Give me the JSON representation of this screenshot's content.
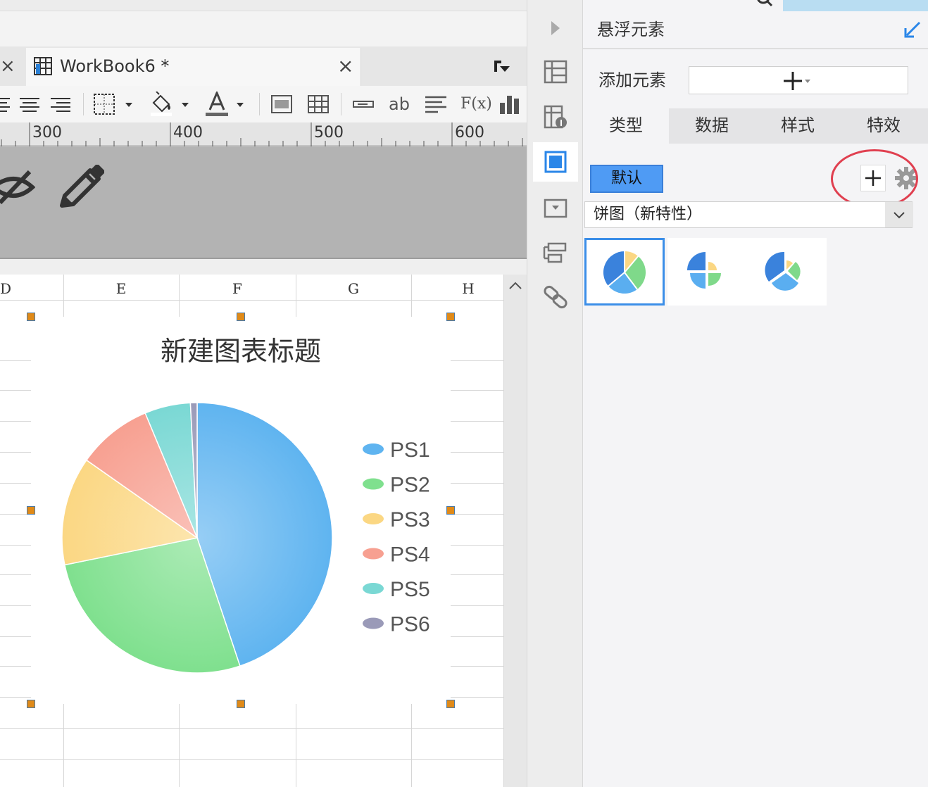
{
  "editor": {
    "tab_title": "WorkBook6 *",
    "toolbar_text": {
      "ab": "ab",
      "fx": "F(x)"
    },
    "ruler_labels": [
      "300",
      "400",
      "500",
      "600"
    ],
    "columns": [
      "D",
      "E",
      "F",
      "G",
      "H"
    ]
  },
  "chart_data": {
    "type": "pie",
    "title": "新建图表标题",
    "categories": [
      "PS1",
      "PS2",
      "PS3",
      "PS4",
      "PS5",
      "PS6"
    ],
    "values": [
      45,
      27,
      13,
      9,
      5.5,
      0.8
    ],
    "colors": [
      "#5fb4f0",
      "#7fe08e",
      "#fbd783",
      "#f7a091",
      "#7ad8d4",
      "#9a9ab8"
    ],
    "legend_position": "right"
  },
  "panel": {
    "title": "悬浮元素",
    "add_element_label": "添加元素",
    "tabs": [
      "类型",
      "数据",
      "样式",
      "特效"
    ],
    "active_tab": "类型",
    "default_button": "默认",
    "chart_type_select": "饼图（新特性）",
    "thumbnails": [
      "pie-chart-thumb",
      "pie-quadrant-thumb",
      "pie-exploded-thumb"
    ]
  },
  "colors": {
    "accent": "#4f9bf4",
    "highlight_circle": "#e04050"
  }
}
